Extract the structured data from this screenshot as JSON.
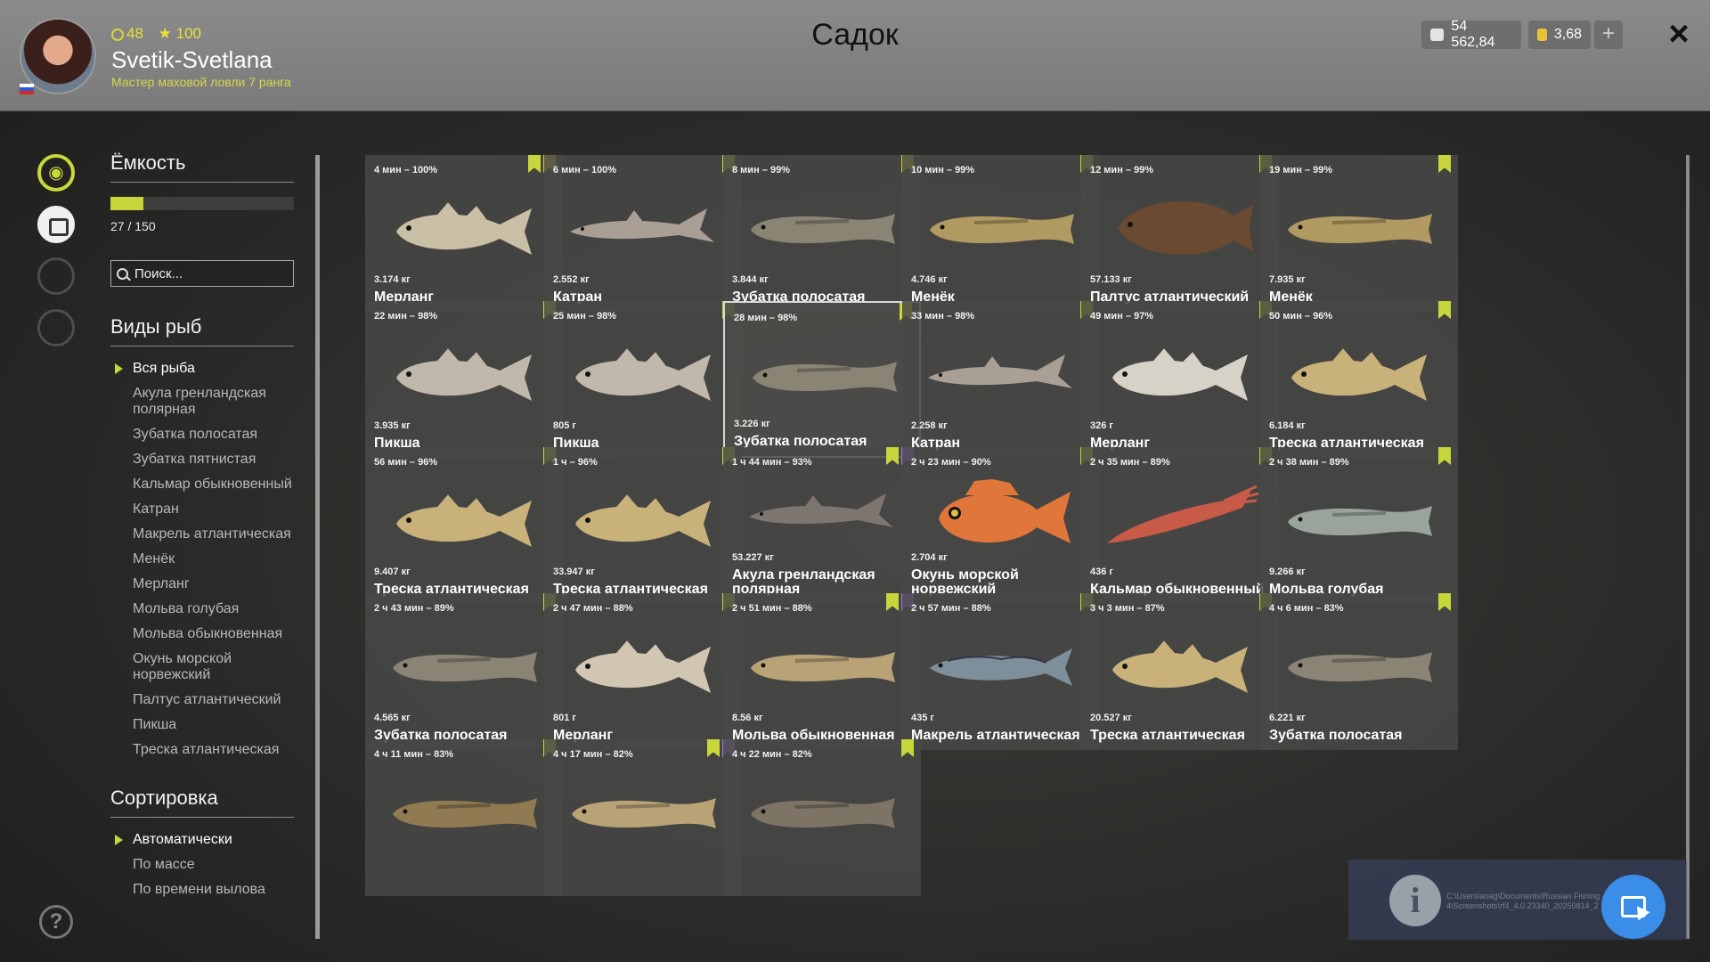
{
  "header": {
    "title": "Садок",
    "username": "Svetik-Svetlana",
    "rank": "Мастер маховой ловли 7 ранга",
    "level": "48",
    "stars": "100",
    "silver": "54 562,84",
    "gold": "3,68",
    "plus_icon": "+",
    "close_icon": "×"
  },
  "sidebar": {
    "capacity_title": "Ёмкость",
    "capacity_text": "27 / 150",
    "capacity_fraction": 0.18,
    "search_placeholder": "Поиск...",
    "species_title": "Виды рыб",
    "species": [
      "Вся рыба",
      "Акула гренландская полярная",
      "Зубатка полосатая",
      "Зубатка пятнистая",
      "Кальмар обыкновенный",
      "Катран",
      "Макрель атлантическая",
      "Менёк",
      "Мерланг",
      "Мольва голубая",
      "Мольва обыкновенная",
      "Окунь морской норвежский",
      "Палтус атлантический",
      "Пикша",
      "Треска атлантическая"
    ],
    "sort_title": "Сортировка",
    "sort_options": [
      "Автоматически",
      "По массе",
      "По времени вылова"
    ]
  },
  "rail_icons": [
    "fish-icon",
    "keepnet-icon",
    "home-icon-dim",
    "home-icon-dim-2"
  ],
  "help_icon": "?",
  "fish": [
    {
      "time": "4 мин – 100%",
      "weight": "3.174 кг",
      "name": "Мерланг",
      "marks": [
        "green",
        "yellow"
      ],
      "color": "#c9bfa5",
      "shape": "cod"
    },
    {
      "time": "6 мин – 100%",
      "weight": "2.552 кг",
      "name": "Катран",
      "marks": [
        "green"
      ],
      "color": "#a99f95",
      "shape": "shark"
    },
    {
      "time": "8 мин – 99%",
      "weight": "3.844 кг",
      "name": "Зубатка полосатая",
      "marks": [
        "green"
      ],
      "color": "#8a8474",
      "shape": "eel"
    },
    {
      "time": "10 мин – 99%",
      "weight": "4.746 кг",
      "name": "Менёк",
      "marks": [
        "green"
      ],
      "color": "#b19a62",
      "shape": "eel"
    },
    {
      "time": "12 мин – 99%",
      "weight": "57.133 кг",
      "name": "Палтус атлантический",
      "marks": [
        "green"
      ],
      "color": "#6b4a32",
      "shape": "flat"
    },
    {
      "time": "19 мин – 99%",
      "weight": "7.935 кг",
      "name": "Менёк",
      "marks": [
        "green"
      ],
      "color": "#b19a62",
      "shape": "eel"
    },
    {
      "time": "22 мин – 98%",
      "weight": "3.935 кг",
      "name": "Пикша",
      "marks": [
        "green"
      ],
      "color": "#c0b8aa",
      "shape": "cod"
    },
    {
      "time": "25 мин – 98%",
      "weight": "805 г",
      "name": "Пикша",
      "marks": [
        "green"
      ],
      "color": "#c0b8aa",
      "shape": "cod"
    },
    {
      "time": "28 мин – 98%",
      "weight": "3.226 кг",
      "name": "Зубатка полосатая",
      "marks": [
        "green"
      ],
      "color": "#8a8474",
      "shape": "eel",
      "selected": true
    },
    {
      "time": "33 мин – 98%",
      "weight": "2.258 кг",
      "name": "Катран",
      "marks": [
        "green"
      ],
      "color": "#a99f95",
      "shape": "shark"
    },
    {
      "time": "49 мин – 97%",
      "weight": "326 г",
      "name": "Мерланг",
      "marks": [
        "green"
      ],
      "color": "#d6d2c8",
      "shape": "cod"
    },
    {
      "time": "50 мин – 96%",
      "weight": "6.184 кг",
      "name": "Треска атлантическая",
      "marks": [
        "green"
      ],
      "color": "#c8b27a",
      "shape": "cod"
    },
    {
      "time": "56 мин – 96%",
      "weight": "9.407 кг",
      "name": "Треска атлантическая",
      "marks": [
        "green"
      ],
      "color": "#c8b27a",
      "shape": "cod"
    },
    {
      "time": "1 ч – 96%",
      "weight": "33.947 кг",
      "name": "Треска атлантическая",
      "marks": [
        "green"
      ],
      "color": "#c8b27a",
      "shape": "cod"
    },
    {
      "time": "1 ч 44 мин – 93%",
      "weight": "53.227 кг",
      "name": "Акула гренландская полярная",
      "marks": [
        "green",
        "purple"
      ],
      "color": "#7d7570",
      "shape": "shark",
      "tall": true
    },
    {
      "time": "2 ч 23 мин – 90%",
      "weight": "2.704 кг",
      "name": "Окунь морской норвежский",
      "marks": [
        "green"
      ],
      "color": "#e0763a",
      "shape": "perch",
      "tall": true
    },
    {
      "time": "2 ч 35 мин – 89%",
      "weight": "436 г",
      "name": "Кальмар обыкновенный",
      "marks": [
        "green"
      ],
      "color": "#c85a48",
      "shape": "squid"
    },
    {
      "time": "2 ч 38 мин – 89%",
      "weight": "9.266 кг",
      "name": "Мольва голубая",
      "marks": [
        "green"
      ],
      "color": "#9aa49c",
      "shape": "eel"
    },
    {
      "time": "2 ч 43 мин – 89%",
      "weight": "4.565 кг",
      "name": "Зубатка полосатая",
      "marks": [
        "green"
      ],
      "color": "#8a8474",
      "shape": "eel"
    },
    {
      "time": "2 ч 47 мин – 88%",
      "weight": "801 г",
      "name": "Мерланг",
      "marks": [
        "green"
      ],
      "color": "#d0c6b2",
      "shape": "cod"
    },
    {
      "time": "2 ч 51 мин – 88%",
      "weight": "8.56 кг",
      "name": "Мольва обыкновенная",
      "marks": [
        "green",
        "purple"
      ],
      "color": "#b9a276",
      "shape": "eel"
    },
    {
      "time": "2 ч 57 мин – 88%",
      "weight": "435 г",
      "name": "Макрель атлантическая",
      "marks": [
        "green"
      ],
      "color": "#7d8f9a",
      "shape": "mackerel"
    },
    {
      "time": "3 ч 3 мин – 87%",
      "weight": "20.527 кг",
      "name": "Треска атлантическая",
      "marks": [
        "green"
      ],
      "color": "#c8b27a",
      "shape": "cod"
    },
    {
      "time": "4 ч 6 мин – 83%",
      "weight": "6.221 кг",
      "name": "Зубатка полосатая",
      "marks": [
        "green"
      ],
      "color": "#8a8474",
      "shape": "eel"
    },
    {
      "time": "4 ч 11 мин – 83%",
      "weight": "",
      "name": "",
      "marks": [
        "green"
      ],
      "color": "#8f7a52",
      "shape": "eel"
    },
    {
      "time": "4 ч 17 мин – 82%",
      "weight": "",
      "name": "",
      "marks": [
        "green",
        "purple"
      ],
      "color": "#b9a276",
      "shape": "eel"
    },
    {
      "time": "4 ч 22 мин – 82%",
      "weight": "",
      "name": "",
      "marks": [
        "green"
      ],
      "color": "#7e7466",
      "shape": "eel"
    }
  ],
  "overlay": {
    "path_text": "C:\\Users\\anag\\Documents\\Russian Fishing 4\\Screenshots\\rf4_4.0.23340_20250814_2",
    "info_icon": "i"
  }
}
